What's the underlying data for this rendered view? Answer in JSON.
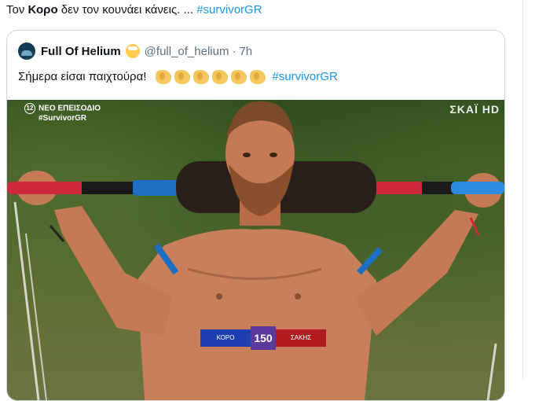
{
  "tweet": {
    "text_before": "Τον ",
    "text_bold": "Κορο",
    "text_after": " δεν τον κουνάει κάνεις. ... ",
    "hashtag": "#survivorGR"
  },
  "quoted_tweet": {
    "display_name": "Full Of Helium",
    "handle": "@full_of_helium",
    "separator": "·",
    "time": "7h",
    "text": "Σήμερα είσαι παιχτούρα!",
    "clap_count": 6,
    "hashtag": "#survivorGR"
  },
  "media": {
    "channel_number": "12",
    "channel_line1": "ΝΕΟ ΕΠΕΙΣΟΔΙΟ",
    "channel_line2": "#SurvivorGR",
    "broadcaster": "ΣΚΑΪ HD",
    "scoreboard": {
      "left_team": "ΚΟΡΟ",
      "score": "150",
      "right_team": "ΣΑΚΗΣ"
    }
  },
  "colors": {
    "hashtag": "#1b95e0",
    "text": "#0f1419",
    "secondary": "#5b7083",
    "border": "#ccd6dd"
  }
}
